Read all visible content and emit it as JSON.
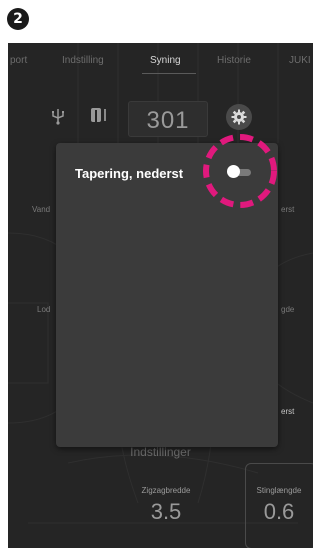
{
  "step": "2",
  "tabs": [
    {
      "label": "port"
    },
    {
      "label": "Indstilling"
    },
    {
      "label": "Syning"
    },
    {
      "label": "Historie"
    },
    {
      "label": "JUKI"
    }
  ],
  "stitch_number": "301",
  "side_labels": {
    "left_top": "Vand",
    "left_mid": "Lod",
    "right_top": "erst",
    "right_mid": "gde",
    "right_low": "erst"
  },
  "popup": {
    "title": "Tapering, nederst",
    "toggle_on": false
  },
  "settings_caption": "Indstillinger",
  "zigzag": {
    "label": "Zigzagbredde",
    "value": "3.5"
  },
  "stitch_length": {
    "label": "Stinglængde",
    "value": "0.6"
  },
  "colors": {
    "screen_bg": "#252525",
    "popup_bg": "#3b3b3b",
    "highlight": "#e0197d"
  }
}
